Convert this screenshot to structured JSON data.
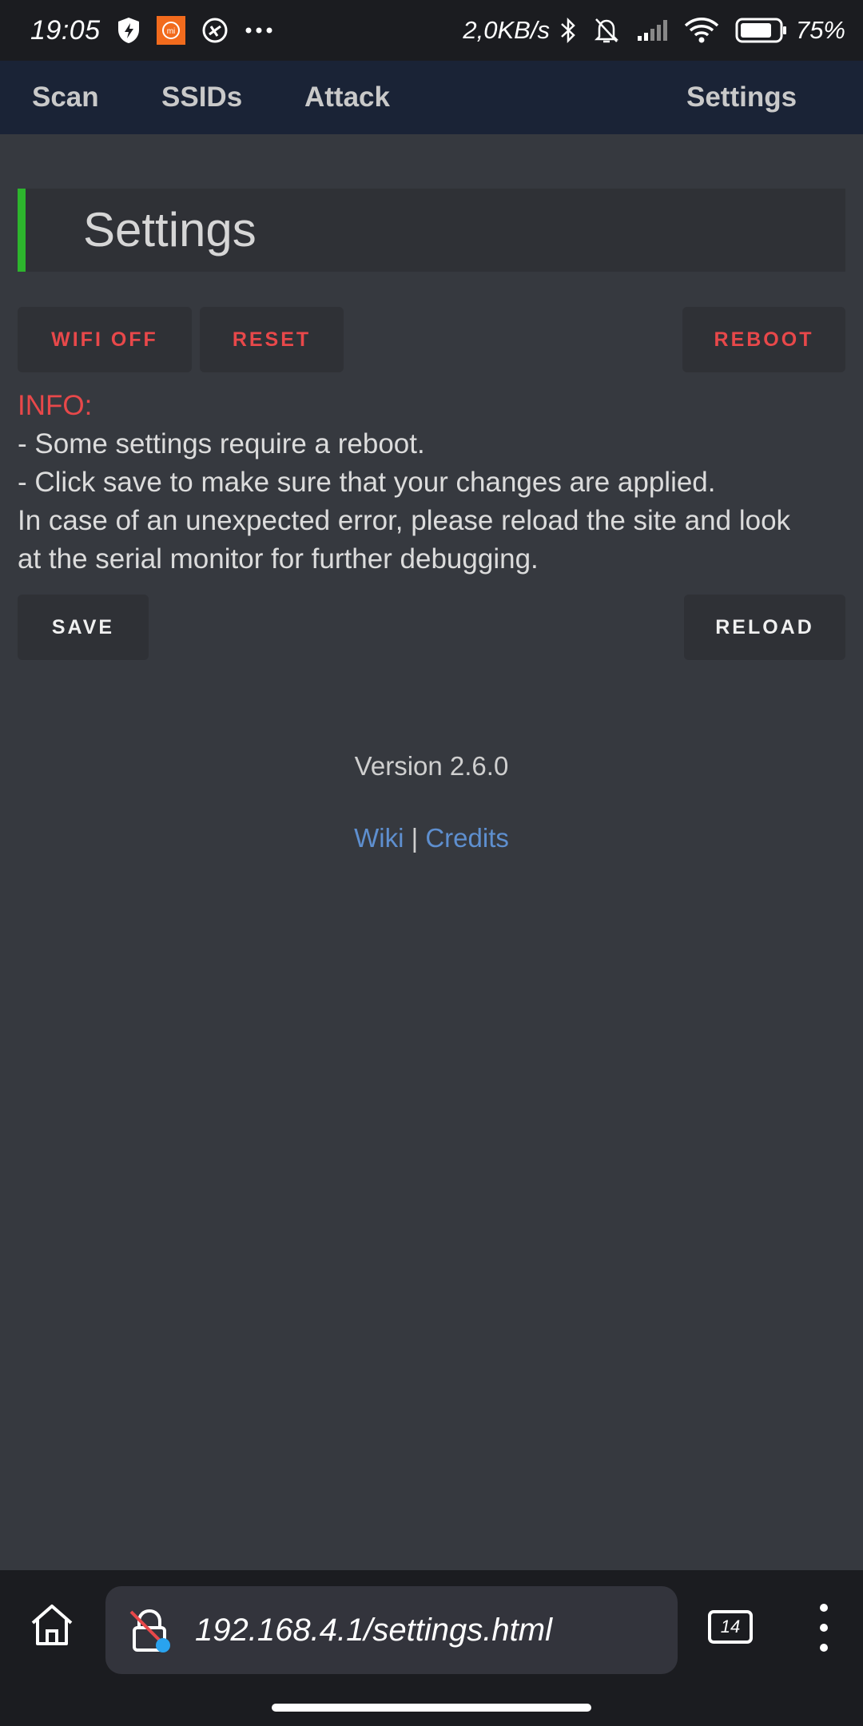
{
  "status_bar": {
    "time": "19:05",
    "net_speed": "2,0KB/s",
    "battery": "75%",
    "icons": [
      "shield-icon",
      "mi-app-icon",
      "globe-icon",
      "more-dots-icon",
      "bluetooth-icon",
      "bell-off-icon",
      "signal-icon",
      "wifi-icon",
      "battery-icon"
    ]
  },
  "nav": {
    "scan": "Scan",
    "ssids": "SSIDs",
    "attack": "Attack",
    "settings": "Settings"
  },
  "page": {
    "title": "Settings",
    "accent_color": "#2db52d"
  },
  "buttons": {
    "wifi_off": "WIFI OFF",
    "reset": "RESET",
    "reboot": "REBOOT",
    "save": "SAVE",
    "reload": "RELOAD"
  },
  "info": {
    "title": "INFO:",
    "line1": "- Some settings require a reboot.",
    "line2": "- Click save to make sure that your changes are applied.",
    "line3": "In case of an unexpected error, please reload the site and look",
    "line4": "at the serial monitor for further debugging."
  },
  "footer": {
    "version": "Version 2.6.0",
    "wiki": "Wiki",
    "separator": "|",
    "credits": "Credits"
  },
  "browser": {
    "url": "192.168.4.1/settings.html",
    "tab_count": "14"
  }
}
